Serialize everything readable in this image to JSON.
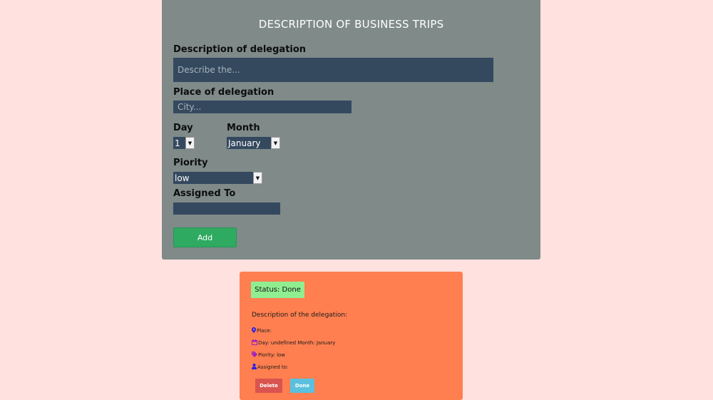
{
  "form": {
    "title": "DESCRIPTION OF BUSINESS TRIPS",
    "description_label": "Description of delegation",
    "description_placeholder": "Describe the...",
    "place_label": "Place of delegation",
    "place_placeholder": "City...",
    "day_label": "Day",
    "day_value": "1",
    "month_label": "Month",
    "month_value": "January",
    "priority_label": "Piority",
    "priority_value": "low",
    "assigned_label": "Assigned To",
    "assigned_value": "",
    "add_label": "Add"
  },
  "card": {
    "status": "Status: Done",
    "description": "Description of the delegation:",
    "place": "Place:",
    "day_month": "Day: undefined Month: January",
    "priority": "Piority: low",
    "assigned": "Assigned to:",
    "delete_label": "Delete",
    "done_label": "Done"
  },
  "colors": {
    "background": "#ffe2df",
    "panel": "#7f8a89",
    "field": "#34495e",
    "add_button": "#2eaa61",
    "card": "#ff7f50",
    "status_badge": "#90ee90",
    "delete_button": "#d9534f",
    "done_button": "#5bc0de",
    "icon_blue": "#2222ee"
  },
  "icons": {
    "place": "map-marker-icon",
    "calendar": "calendar-icon",
    "priority": "tag-icon",
    "user": "user-icon",
    "dropdown": "chevron-down-icon"
  }
}
